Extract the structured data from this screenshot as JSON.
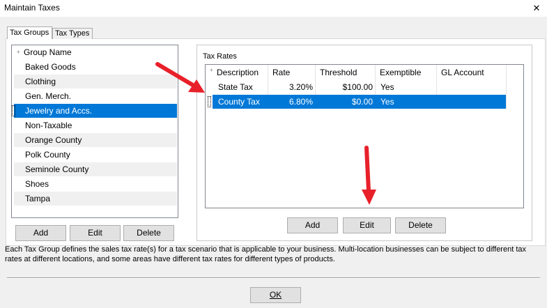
{
  "window": {
    "title": "Maintain Taxes",
    "close_glyph": "✕"
  },
  "tabs": [
    {
      "label": "Tax Groups",
      "active": true
    },
    {
      "label": "Tax Types",
      "active": false
    }
  ],
  "groups": {
    "header": "Group Name",
    "items": [
      "Baked Goods",
      "Clothing",
      "Gen. Merch.",
      "Jewelry and Accs.",
      "Non-Taxable",
      "Orange County",
      "Polk County",
      "Seminole County",
      "Shoes",
      "Tampa"
    ],
    "selected_index": 3,
    "buttons": {
      "add": "Add",
      "edit": "Edit",
      "delete": "Delete"
    }
  },
  "tax_rates": {
    "label": "Tax Rates",
    "columns": [
      "Description",
      "Rate",
      "Threshold",
      "Exemptible",
      "GL Account"
    ],
    "rows": [
      {
        "description": "State Tax",
        "rate": "3.20%",
        "threshold": "$100.00",
        "exemptible": "Yes",
        "gl_account": ""
      },
      {
        "description": "County Tax",
        "rate": "6.80%",
        "threshold": "$0.00",
        "exemptible": "Yes",
        "gl_account": ""
      }
    ],
    "selected_index": 1,
    "buttons": {
      "add": "Add",
      "edit": "Edit",
      "delete": "Delete"
    }
  },
  "description": "Each Tax Group defines the sales tax rate(s) for a tax scenario that is applicable to your business. Multi-location businesses can be subject to different tax rates at different locations, and some areas have different tax rates for different types of products.",
  "footer": {
    "ok_label": "OK"
  },
  "colors": {
    "selection": "#0078d7",
    "annotation_arrow": "#e8202a"
  },
  "icons": [
    "close-icon",
    "annotation-arrow-icon"
  ]
}
